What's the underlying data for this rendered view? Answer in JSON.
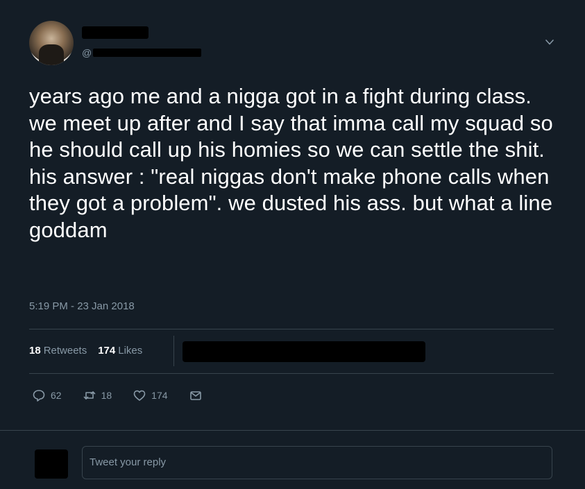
{
  "tweet": {
    "handle_prefix": "@",
    "text": "years ago me and a nigga got in a fight during class. we meet up after and I say that imma call my squad so he should call up his homies so we can settle the shit. his answer : \"real niggas don't make phone calls when they got a problem\". we dusted his ass. but what a line goddam",
    "timestamp": "5:19 PM - 23 Jan 2018"
  },
  "stats": {
    "retweets_count": "18",
    "retweets_label": "Retweets",
    "likes_count": "174",
    "likes_label": "Likes"
  },
  "actions": {
    "reply_count": "62",
    "retweet_count": "18",
    "like_count": "174"
  },
  "reply": {
    "placeholder": "Tweet your reply"
  },
  "colors": {
    "background": "#141d26",
    "muted": "#8899a6",
    "border": "#38444d"
  },
  "icons": [
    "chevron-down-icon",
    "reply-icon",
    "retweet-icon",
    "like-icon",
    "direct-message-icon"
  ]
}
